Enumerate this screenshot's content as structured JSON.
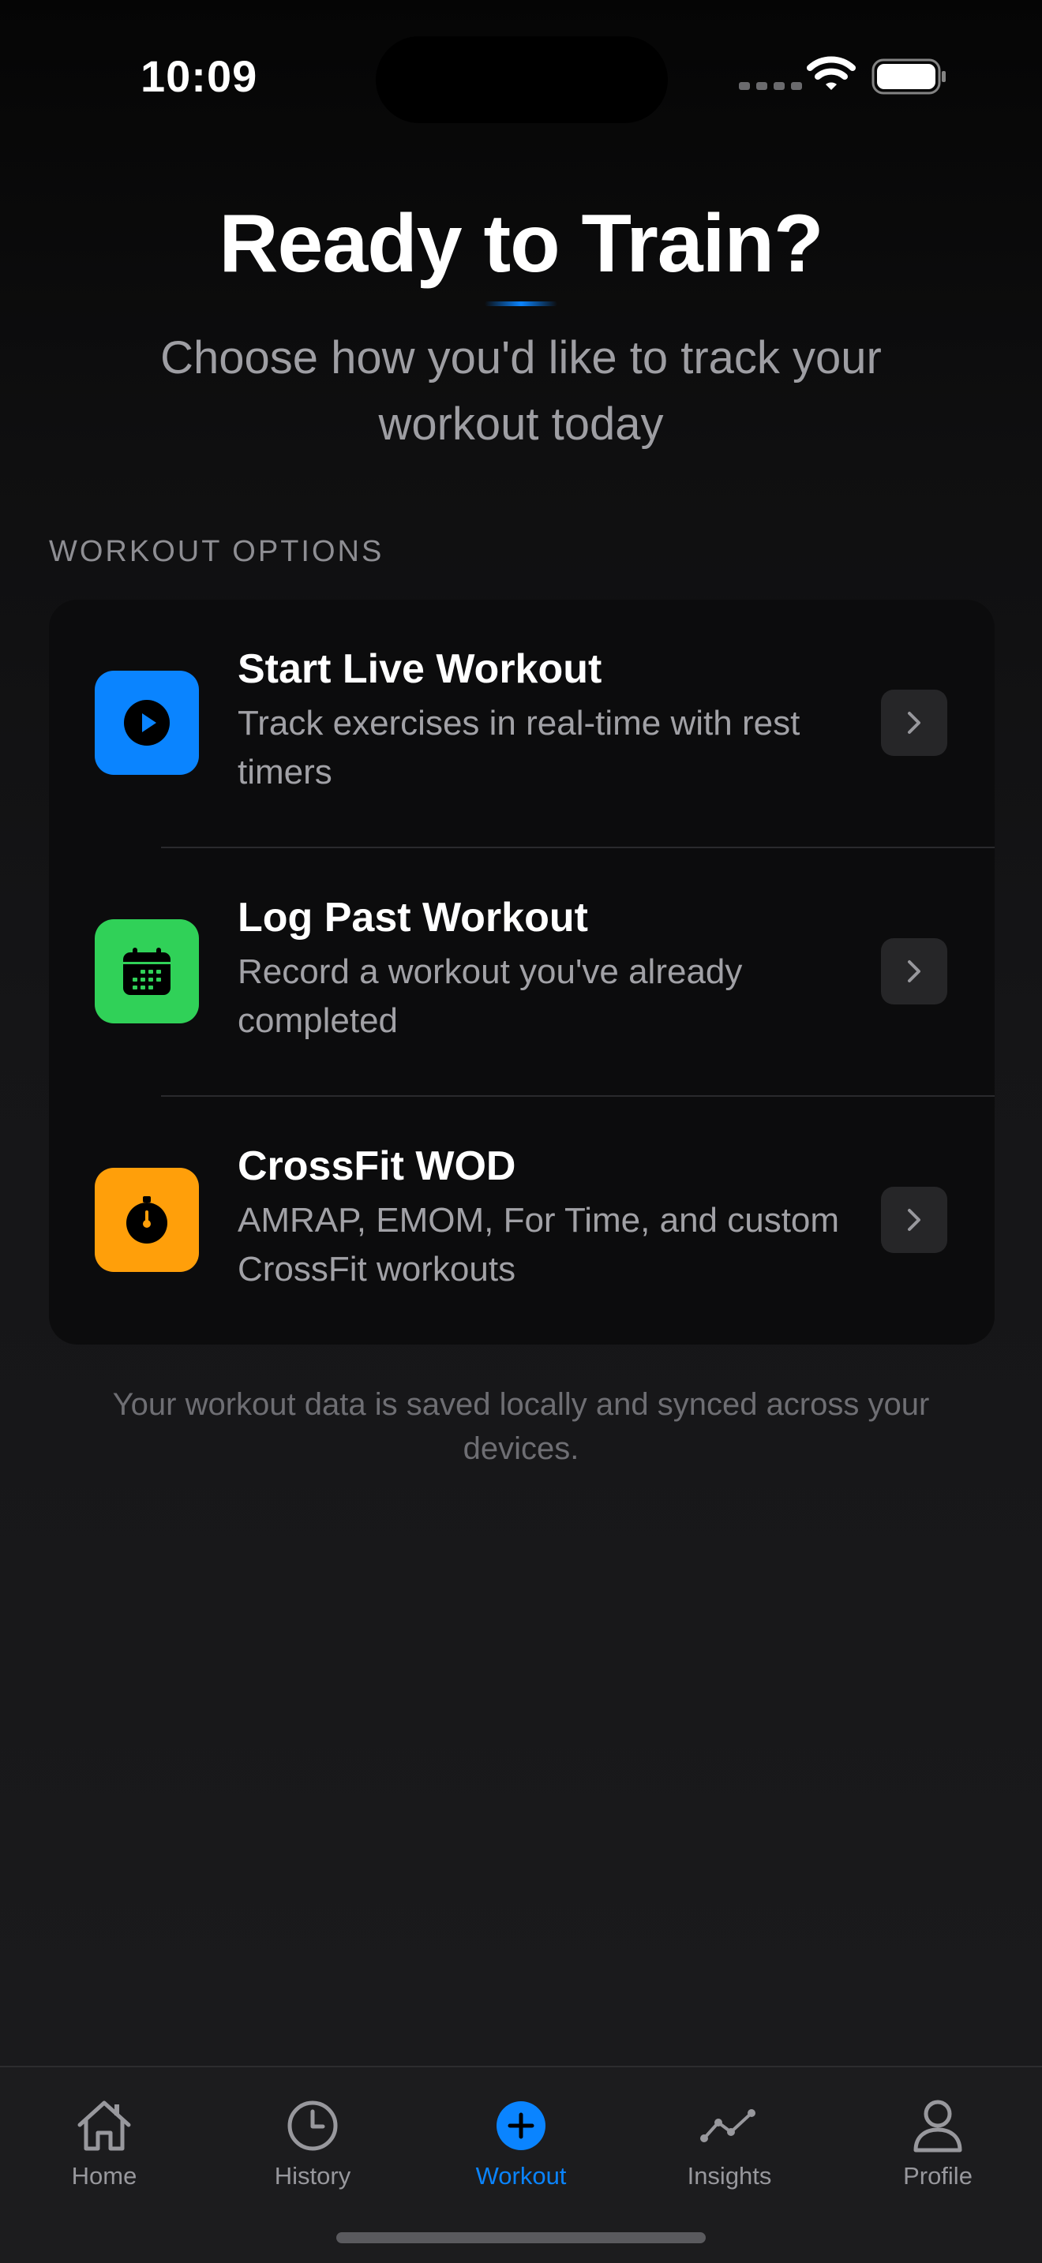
{
  "status_bar": {
    "time": "10:09"
  },
  "header": {
    "title": "Ready to Train?",
    "subtitle": "Choose how you'd like to track your workout today"
  },
  "section": {
    "label": "WORKOUT OPTIONS"
  },
  "options": [
    {
      "title": "Start Live Workout",
      "description": "Track exercises in real-time with rest timers",
      "icon": "play-icon",
      "color": "#0a84ff"
    },
    {
      "title": "Log Past Workout",
      "description": "Record a workout you've already completed",
      "icon": "calendar-icon",
      "color": "#30d158"
    },
    {
      "title": "CrossFit WOD",
      "description": "AMRAP, EMOM, For Time, and custom CrossFit workouts",
      "icon": "stopwatch-icon",
      "color": "#ff9f0a"
    }
  ],
  "footnote": "Your workout data is saved locally and synced across your devices.",
  "tab_bar": {
    "active_color": "#0a84ff",
    "tabs": [
      {
        "label": "Home",
        "icon": "house-icon"
      },
      {
        "label": "History",
        "icon": "clock-icon"
      },
      {
        "label": "Workout",
        "icon": "plus-circle-icon",
        "active": true
      },
      {
        "label": "Insights",
        "icon": "chart-line-icon"
      },
      {
        "label": "Profile",
        "icon": "person-icon"
      }
    ]
  }
}
